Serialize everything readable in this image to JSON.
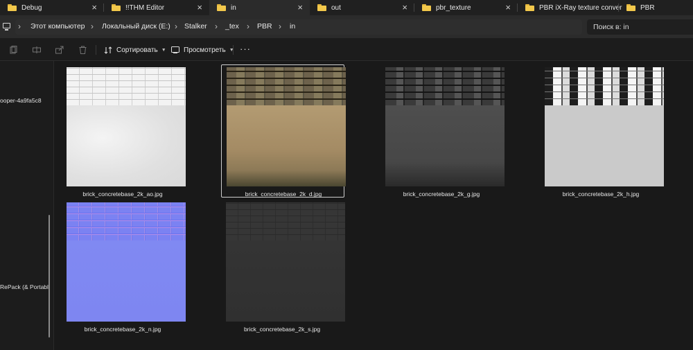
{
  "tabs": [
    {
      "label": "Debug",
      "active": false
    },
    {
      "label": "!!THM Editor",
      "active": false
    },
    {
      "label": "in",
      "active": true
    },
    {
      "label": "out",
      "active": false
    },
    {
      "label": "pbr_texture",
      "active": false
    },
    {
      "label": "PBR iX-Ray texture conver",
      "active": false
    },
    {
      "label": "PBR",
      "active": false
    }
  ],
  "address": {
    "crumbs": [
      "Этот компьютер",
      "Локальный диск (E:)",
      "Stalker",
      "_tex",
      "PBR",
      "in"
    ],
    "search_placeholder": "Поиск в: in"
  },
  "commands": {
    "sort_label": "Сортировать",
    "view_label": "Просмотреть",
    "more_label": "···"
  },
  "nav": {
    "items": [
      {
        "label": "ooper-4a9fa5c8"
      },
      {
        "label": "RePack (& Portabl"
      }
    ]
  },
  "files": [
    {
      "name": "brick_concretebase_2k_ao.jpg",
      "selected": false
    },
    {
      "name": "brick_concretebase_2k_d.jpg",
      "selected": true
    },
    {
      "name": "brick_concretebase_2k_g.jpg",
      "selected": false
    },
    {
      "name": "brick_concretebase_2k_h.jpg",
      "selected": false
    },
    {
      "name": "brick_concretebase_2k_n.jpg",
      "selected": false
    },
    {
      "name": "brick_concretebase_2k_s.jpg",
      "selected": false
    }
  ],
  "colors": {
    "folder": "#f2c84b",
    "background": "#1c1c1c",
    "selection_border": "#cfcfcf"
  }
}
